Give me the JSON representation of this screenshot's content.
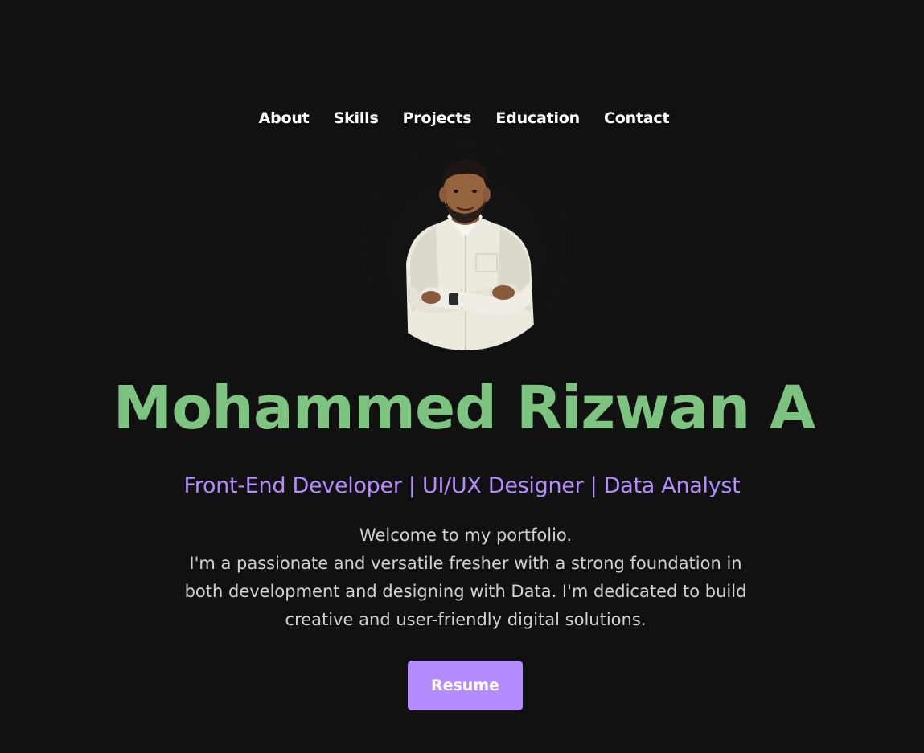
{
  "nav": {
    "items": [
      {
        "label": "About"
      },
      {
        "label": "Skills"
      },
      {
        "label": "Projects"
      },
      {
        "label": "Education"
      },
      {
        "label": "Contact"
      }
    ]
  },
  "hero": {
    "name": "Mohammed Rizwan A",
    "subtitle": "Front-End Developer | UI/UX Designer | Data Analyst",
    "intro_lines": [
      "Welcome to my portfolio.",
      "I'm a passionate and versatile fresher with a strong foundation in",
      "both development and designing with Data. I'm dedicated to build",
      "creative and user-friendly digital solutions."
    ],
    "resume_label": "Resume"
  },
  "colors": {
    "background": "#111111",
    "name_green": "#7cc47f",
    "accent_purple": "#b58cff",
    "body_text": "#d2d2d2"
  }
}
